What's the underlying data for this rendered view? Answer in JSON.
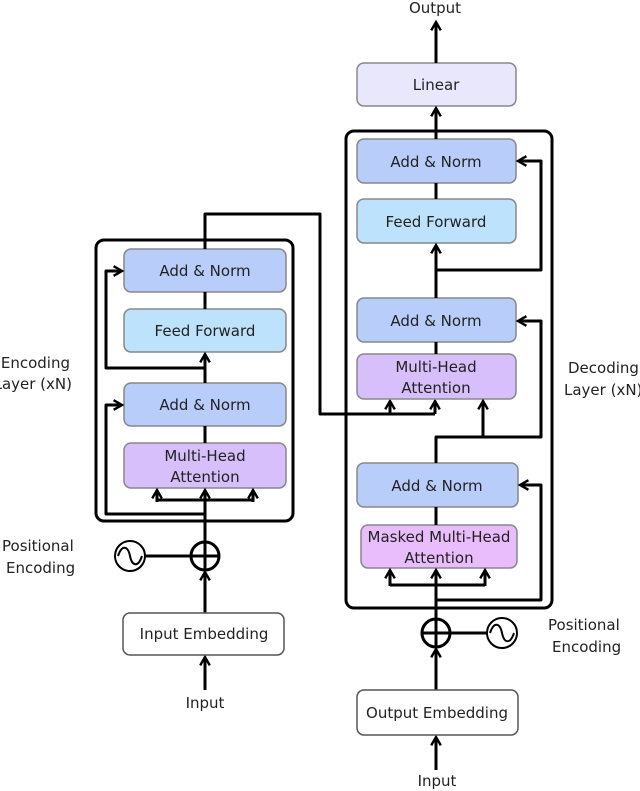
{
  "colors": {
    "add_norm": "#b9cdfb",
    "feed_forward": "#bde2fc",
    "multi_head_attention": "#d7bffb",
    "masked_attention": "#e9bdfb",
    "linear": "#e9e7fc",
    "embedding": "#ffffff"
  },
  "encoder": {
    "label_line1": "Encoding",
    "label_line2": "Layer (xN)",
    "add_norm_top": "Add & Norm",
    "feed_forward": "Feed Forward",
    "add_norm_bottom": "Add & Norm",
    "attention_line1": "Multi-Head",
    "attention_line2": "Attention",
    "pos_enc_line1": "Positional",
    "pos_enc_line2": "Encoding",
    "embedding": "Input Embedding",
    "input": "Input"
  },
  "decoder": {
    "label_line1": "Decoding",
    "label_line2": "Layer (xN)",
    "output": "Output",
    "linear": "Linear",
    "add_norm_3": "Add & Norm",
    "feed_forward": "Feed Forward",
    "add_norm_2": "Add & Norm",
    "attention_line1": "Multi-Head",
    "attention_line2": "Attention",
    "add_norm_1": "Add & Norm",
    "masked_line1": "Masked Multi-Head",
    "masked_line2": "Attention",
    "pos_enc_line1": "Positional",
    "pos_enc_line2": "Encoding",
    "embedding": "Output Embedding",
    "input": "Input"
  }
}
